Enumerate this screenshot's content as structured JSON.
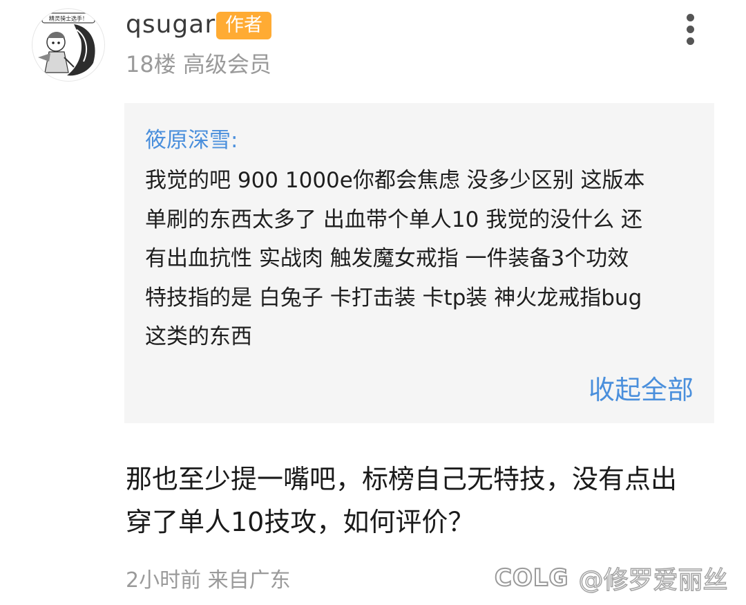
{
  "post": {
    "username": "qsugar",
    "author_badge": "作者",
    "floor_meta": "18楼 高级会员",
    "avatar_icon": "knight-cartoon-avatar",
    "avatar_caption": "精灵骑士选手！"
  },
  "quote": {
    "author": "筱原深雪:",
    "lines": [
      "我觉的吧 900 1000e你都会焦虑 没多少区别 这版本",
      "单刷的东西太多了  出血带个单人10 我觉的没什么 还",
      "有出血抗性 实战肉 触发魔女戒指 一件装备3个功效",
      "特技指的是 白兔子 卡打击装 卡tp装 神火龙戒指bug",
      "这类的东西"
    ],
    "collapse_label": "收起全部"
  },
  "reply": {
    "lines": [
      "那也至少提一嘴吧，标榜自己无特技，没有点出",
      "穿了单人10技攻，如何评价？"
    ]
  },
  "footer": {
    "time_location": "2小时前 来自广东"
  },
  "watermark": {
    "logo": "COLG",
    "handle": "@修罗爱丽丝"
  },
  "colors": {
    "accent_blue": "#4a8fdc",
    "badge_orange": "#ffab33",
    "meta_gray": "#9a9a9a",
    "quote_bg": "#f5f5f5"
  }
}
